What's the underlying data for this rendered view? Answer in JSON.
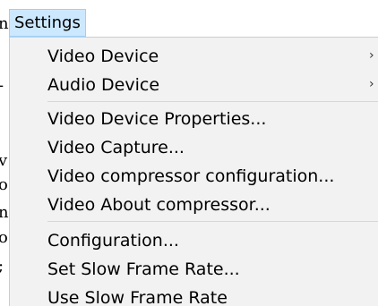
{
  "menubar": {
    "title": "Settings"
  },
  "background": {
    "left_text_fragments": [
      "n",
      "-",
      "v",
      "o",
      "n",
      "o",
      ";"
    ]
  },
  "menu": {
    "items": [
      {
        "label": "Video Device",
        "submenu_icon": "chevron-right-icon",
        "submenu_glyph": "›"
      },
      {
        "label": "Audio Device",
        "submenu_icon": "chevron-right-icon",
        "submenu_glyph": "›"
      },
      {
        "label": "Video Device Properties..."
      },
      {
        "label": "Video Capture..."
      },
      {
        "label": "Video compressor configuration..."
      },
      {
        "label": "Video About compressor..."
      },
      {
        "label": "Configuration..."
      },
      {
        "label": "Set Slow Frame Rate..."
      },
      {
        "label": "Use Slow Frame Rate"
      }
    ]
  },
  "colors": {
    "menubar_highlight": "#cce8ff",
    "menubar_highlight_border": "#99d1ff",
    "menu_background": "#f2f2f2",
    "separator": "#d7d7d7"
  }
}
